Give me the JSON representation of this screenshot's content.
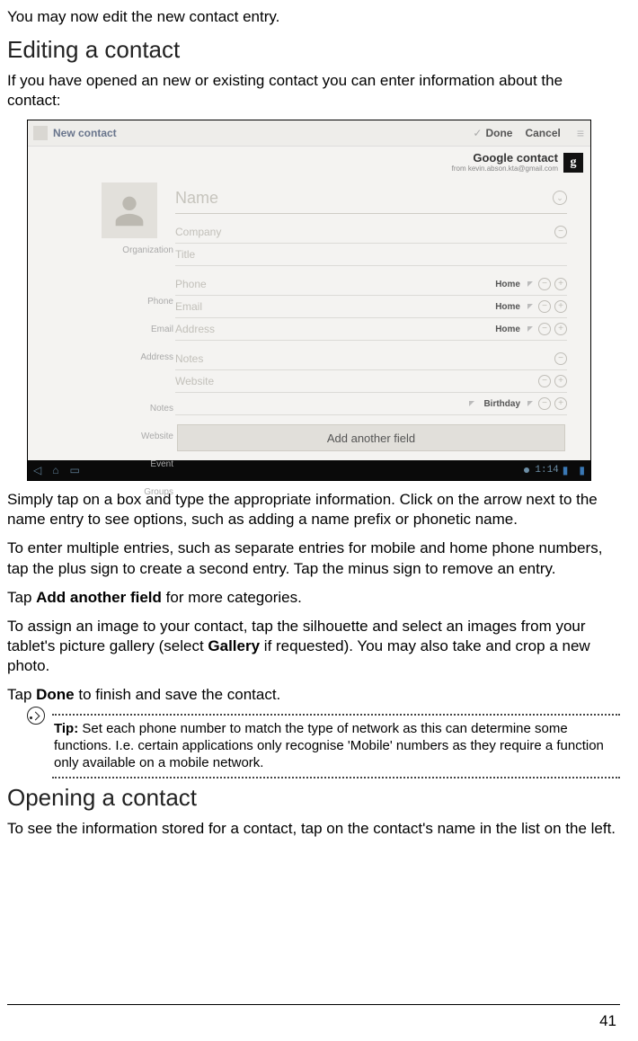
{
  "intro_line": "You may now edit the new contact entry.",
  "h_edit": "Editing a contact",
  "edit_p1": "If you have opened an new or existing contact you can enter information about the contact:",
  "shot": {
    "topbar_title": "New contact",
    "done": "Done",
    "cancel": "Cancel",
    "gcontact": "Google contact",
    "gfrom": "from kevin.abson.kta@gmail.com",
    "gbadge": "g",
    "labels": {
      "org": "Organization",
      "phone": "Phone",
      "email": "Email",
      "address": "Address",
      "notes": "Notes",
      "website": "Website",
      "event": "Event",
      "groups": "Groups"
    },
    "ph": {
      "name": "Name",
      "company": "Company",
      "title": "Title",
      "phone": "Phone",
      "email": "Email",
      "address": "Address",
      "notes": "Notes",
      "website": "Website"
    },
    "type_home": "Home",
    "type_birthday": "Birthday",
    "add_another": "Add another field",
    "clock": "1:14"
  },
  "p_after1": "Simply tap on a box and type the appropriate information. Click on the arrow next to the name entry to see options, such as adding a name prefix or phonetic name.",
  "p_after2": "To enter multiple entries, such as separate entries for mobile and home phone numbers, tap the plus sign to create a second entry. Tap the minus sign to remove an entry.",
  "p_after3_a": "Tap ",
  "p_after3_b": "Add another field",
  "p_after3_c": " for more categories.",
  "p_after4_a": "To assign an image to your contact, tap the silhouette and select an images from your tablet's picture gallery (select ",
  "p_after4_b": "Gallery",
  "p_after4_c": " if requested). You may also take and crop a new photo.",
  "p_after5_a": "Tap ",
  "p_after5_b": "Done",
  "p_after5_c": " to finish and save the contact.",
  "tip_label": "Tip:",
  "tip_text": " Set each phone number to match the type of network as this can determine some functions. I.e. certain applications only recognise 'Mobile' numbers as they require a function only available on a mobile network.",
  "h_open": "Opening a contact",
  "open_p1": "To see the information stored for a contact, tap on the contact's name in the list on the left.",
  "pagenum": "41"
}
